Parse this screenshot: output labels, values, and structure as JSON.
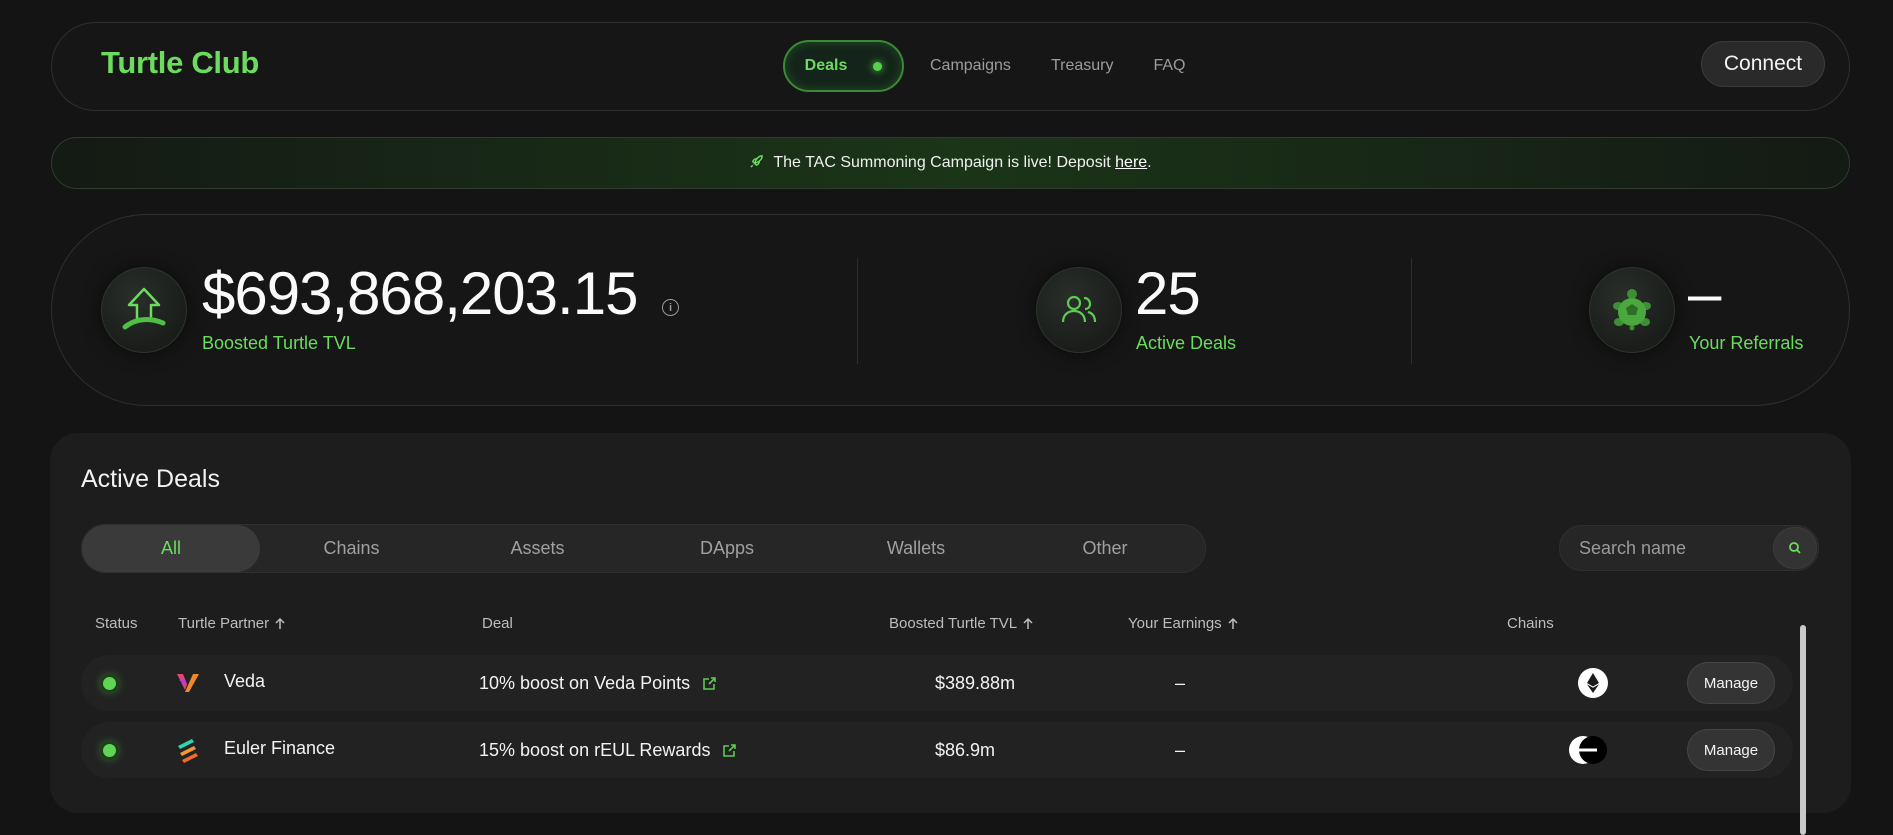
{
  "header": {
    "brand": "Turtle Club",
    "nav": [
      {
        "label": "Deals",
        "active": true
      },
      {
        "label": "Campaigns"
      },
      {
        "label": "Treasury"
      },
      {
        "label": "FAQ"
      }
    ],
    "connect_label": "Connect"
  },
  "banner": {
    "icon": "rocket-icon",
    "text": "The TAC Summoning Campaign is live! Deposit ",
    "link_text": "here",
    "suffix": "."
  },
  "stats": {
    "tvl": {
      "value": "$693,868,203.15",
      "label": "Boosted Turtle TVL",
      "icon": "arrow-up-icon"
    },
    "deals": {
      "value": "25",
      "label": "Active Deals",
      "icon": "users-icon"
    },
    "referrals": {
      "value": "–",
      "label": "Your Referrals",
      "icon": "turtle-icon"
    }
  },
  "deals": {
    "title": "Active Deals",
    "filters": [
      "All",
      "Chains",
      "Assets",
      "DApps",
      "Wallets",
      "Other"
    ],
    "active_filter": "All",
    "search": {
      "placeholder": "Search name"
    },
    "columns": {
      "status": "Status",
      "partner": "Turtle Partner",
      "deal": "Deal",
      "tvl": "Boosted Turtle TVL",
      "earnings": "Your Earnings",
      "chains": "Chains"
    },
    "rows": [
      {
        "partner": "Veda",
        "deal": "10% boost on Veda Points",
        "tvl": "$389.88m",
        "earnings": "–",
        "chain": "ethereum-icon",
        "action": "Manage"
      },
      {
        "partner": "Euler Finance",
        "deal": "15% boost on rEUL Rewards",
        "tvl": "$86.9m",
        "earnings": "–",
        "chain": "chain-icon",
        "action": "Manage"
      }
    ]
  },
  "colors": {
    "accent": "#6bdc5e",
    "background": "#141414",
    "panel": "#1d1d1d"
  }
}
